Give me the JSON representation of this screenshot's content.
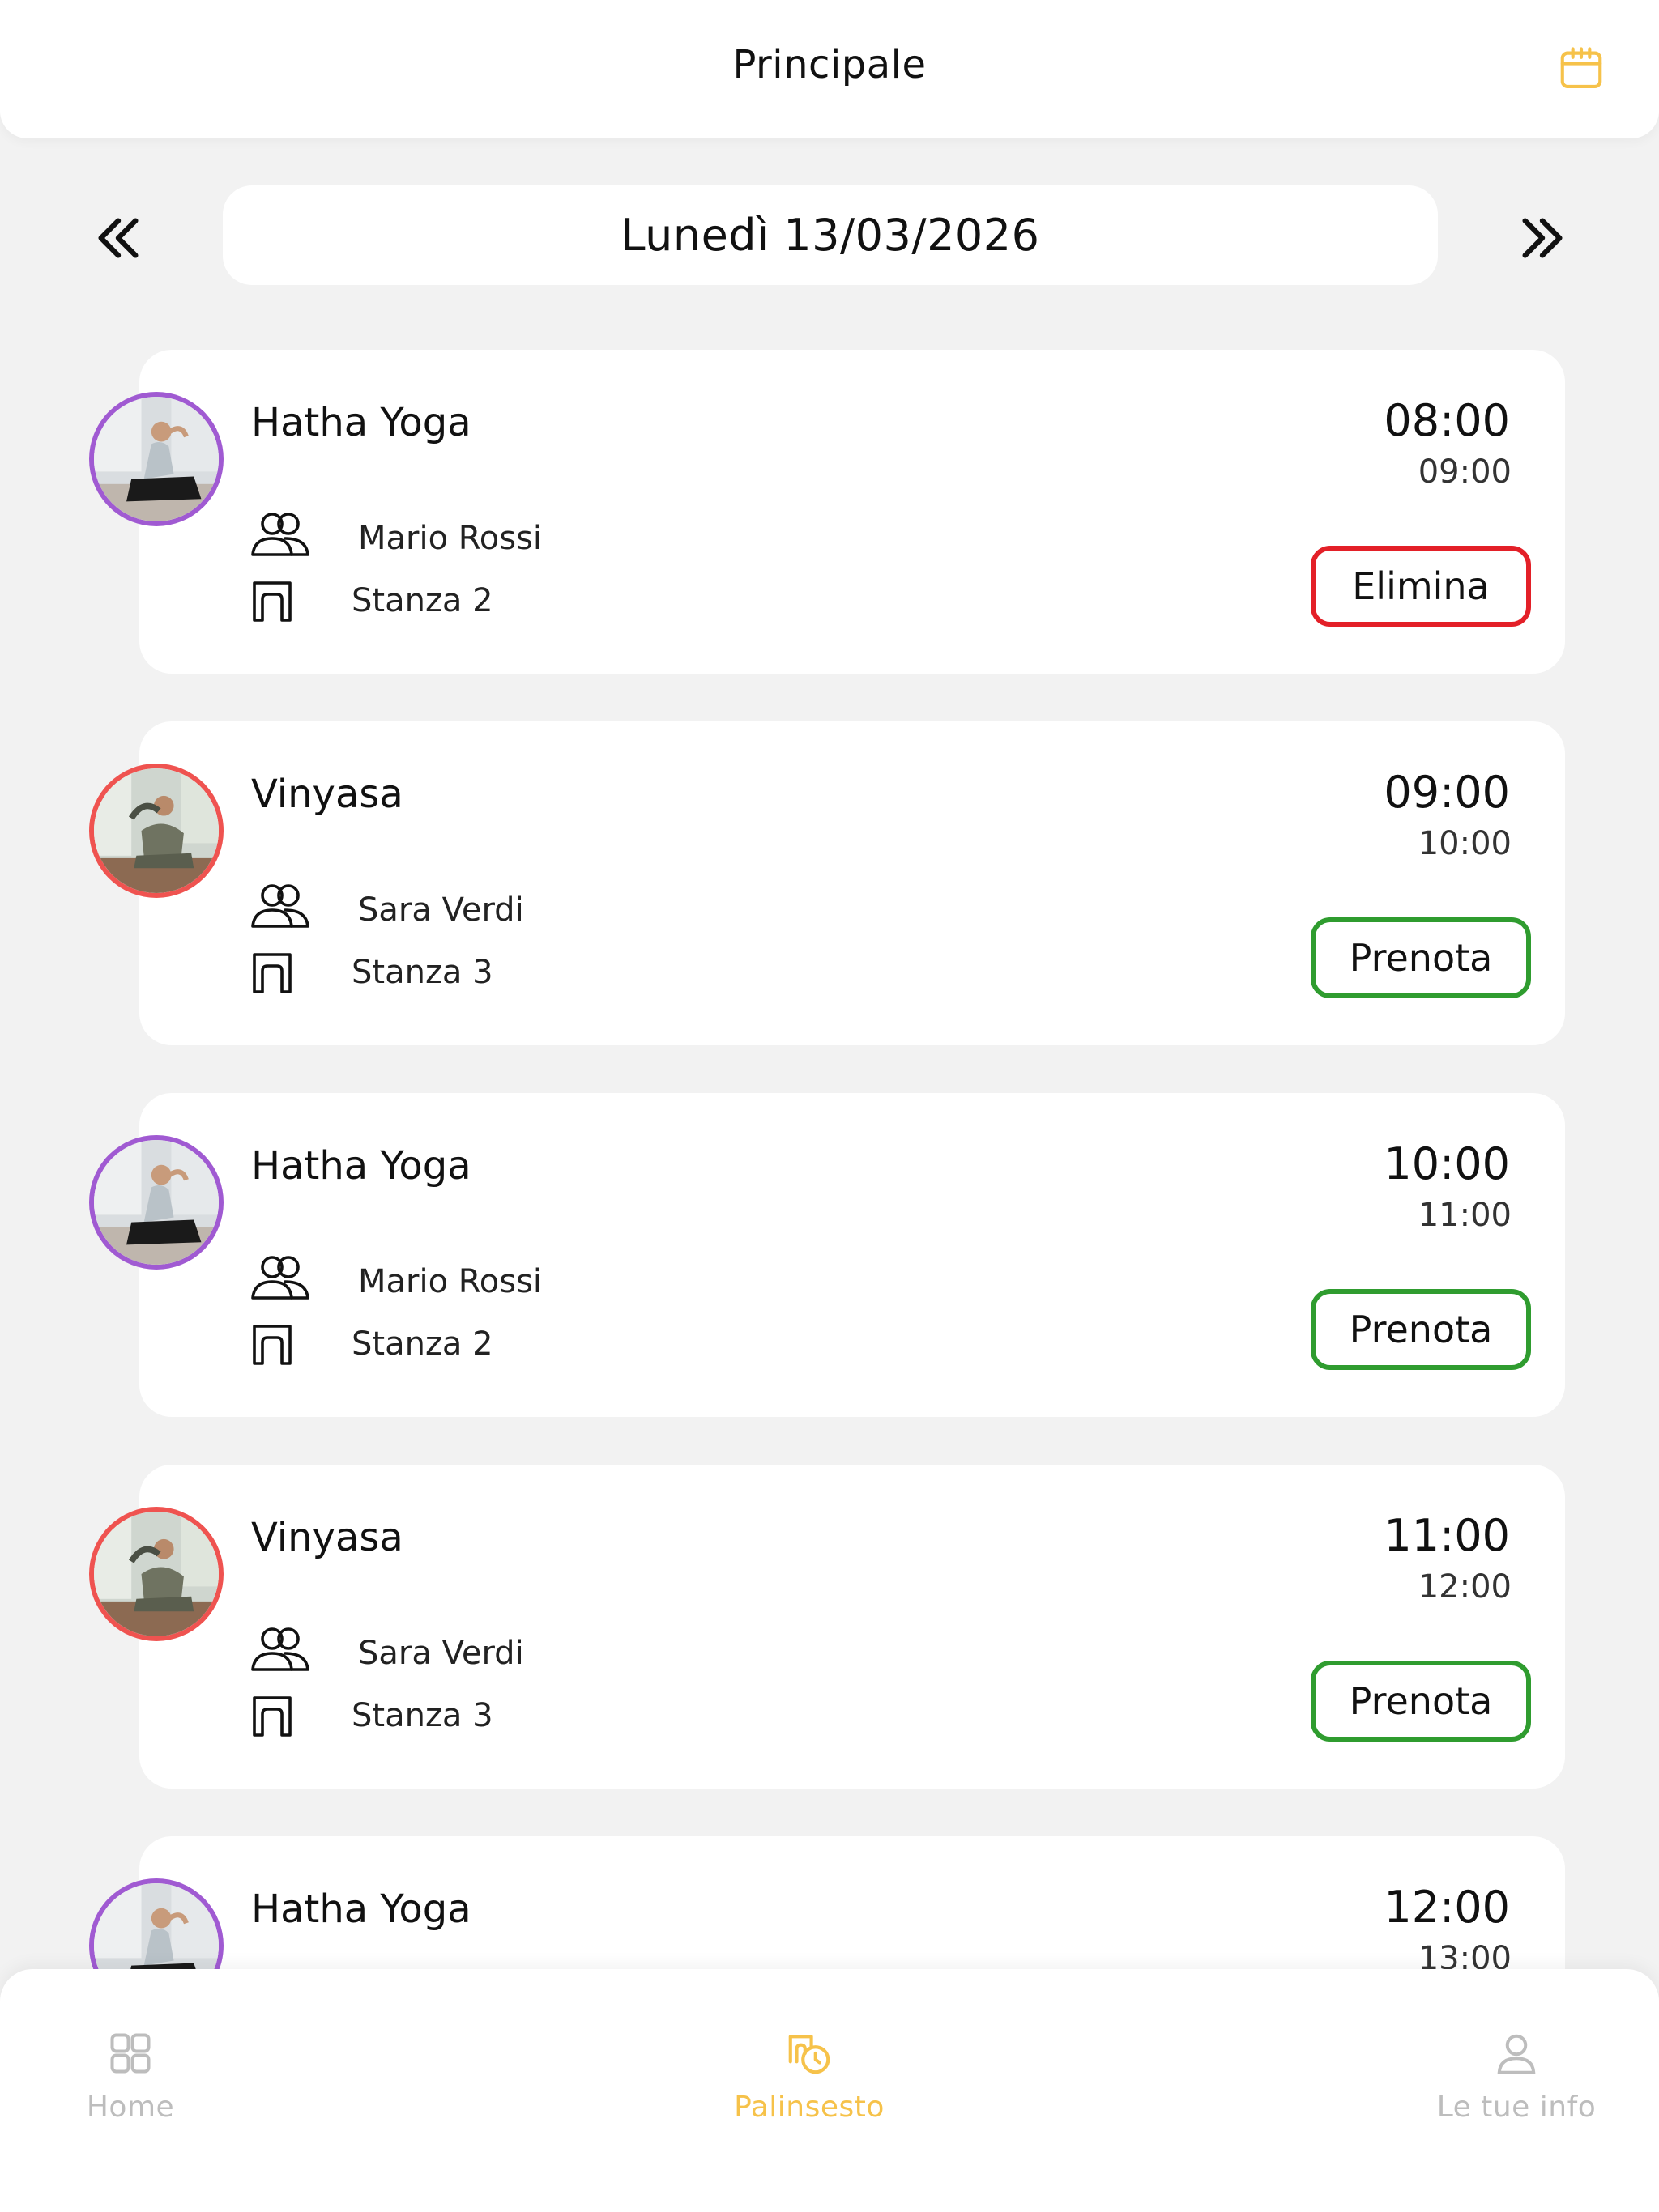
{
  "header": {
    "title": "Principale",
    "calendar_icon": "calendar-icon"
  },
  "date_nav": {
    "date": "Lunedì 13/03/2026",
    "prev_icon": "chevron-double-left-icon",
    "next_icon": "chevron-double-right-icon"
  },
  "classes": [
    {
      "name": "Hatha Yoga",
      "teacher": "Mario Rossi",
      "room": "Stanza 2",
      "start": "08:00",
      "end": "09:00",
      "action": "Elimina",
      "ring_color": "#a05ad2"
    },
    {
      "name": "Vinyasa",
      "teacher": "Sara Verdi",
      "room": "Stanza 3",
      "start": "09:00",
      "end": "10:00",
      "action": "Prenota",
      "ring_color": "#ef5350"
    },
    {
      "name": "Hatha Yoga",
      "teacher": "Mario Rossi",
      "room": "Stanza 2",
      "start": "10:00",
      "end": "11:00",
      "action": "Prenota",
      "ring_color": "#a05ad2"
    },
    {
      "name": "Vinyasa",
      "teacher": "Sara Verdi",
      "room": "Stanza 3",
      "start": "11:00",
      "end": "12:00",
      "action": "Prenota",
      "ring_color": "#ef5350"
    },
    {
      "name": "Hatha Yoga",
      "start": "12:00",
      "end": "13:00",
      "ring_color": "#a05ad2"
    }
  ],
  "tabbar": {
    "home": "Home",
    "schedule": "Palinsesto",
    "info": "Le tue info"
  },
  "colors": {
    "accent": "#f6c24a",
    "book_border": "#2f9c2f",
    "delete_border": "#e32028",
    "background": "#f2f2f2"
  }
}
